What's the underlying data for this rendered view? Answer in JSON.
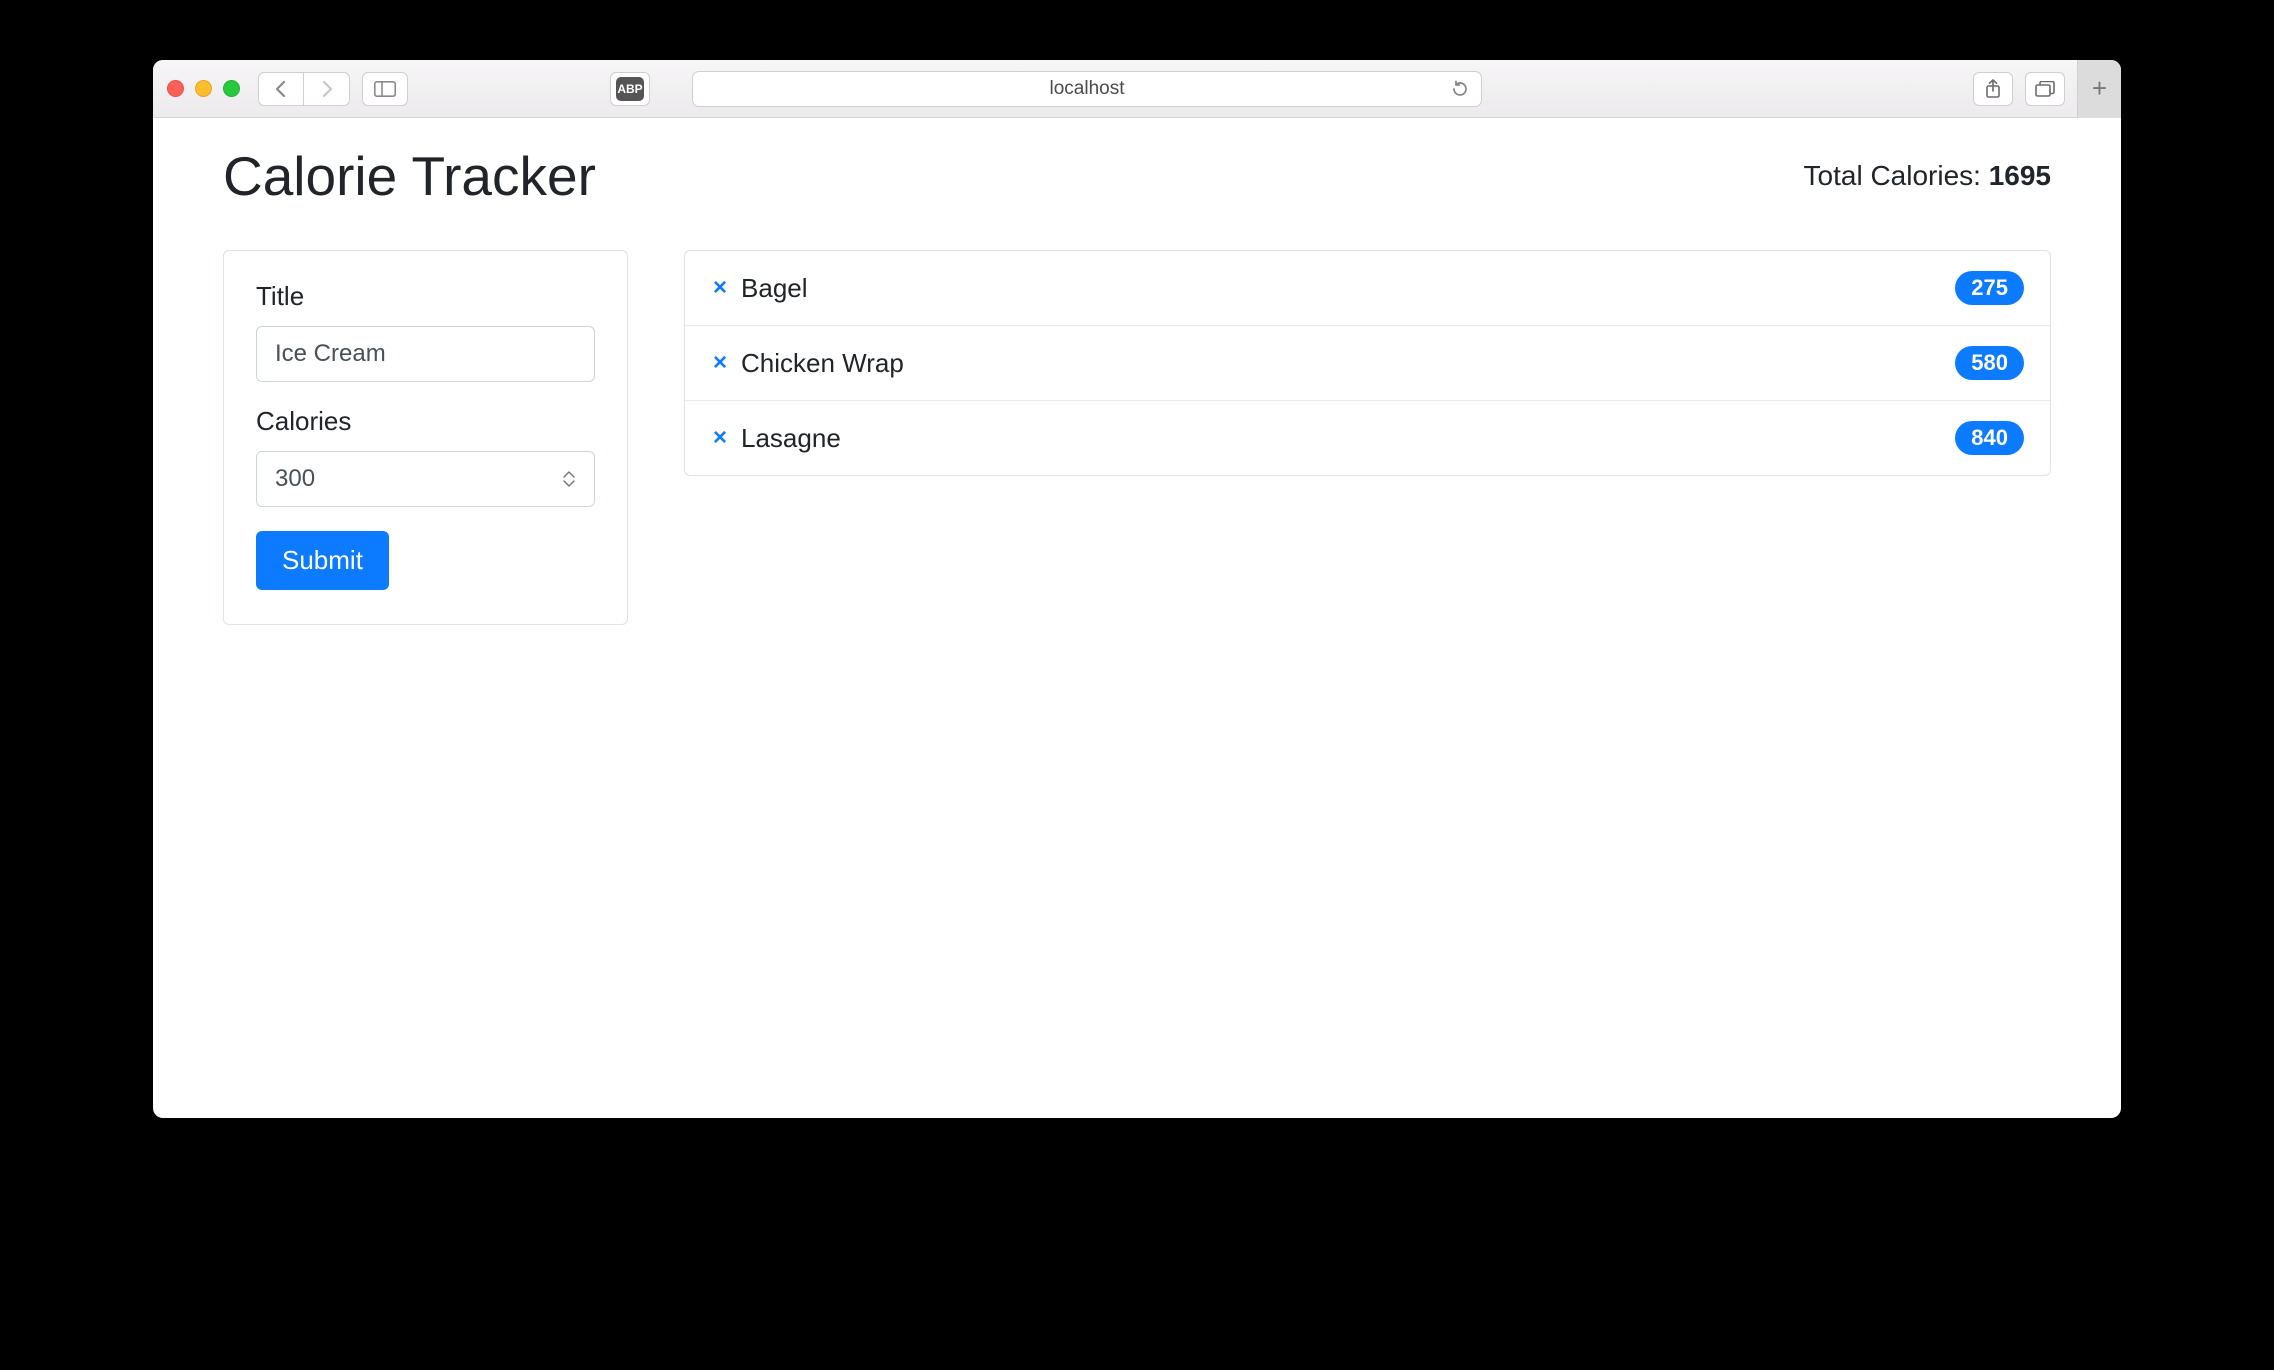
{
  "browser": {
    "address": "localhost",
    "abp_label": "ABP"
  },
  "header": {
    "title": "Calorie Tracker",
    "total_label": "Total Calories: ",
    "total_value": "1695"
  },
  "form": {
    "title_label": "Title",
    "title_value": "Ice Cream",
    "calories_label": "Calories",
    "calories_value": "300",
    "submit_label": "Submit"
  },
  "items": [
    {
      "name": "Bagel",
      "calories": "275"
    },
    {
      "name": "Chicken Wrap",
      "calories": "580"
    },
    {
      "name": "Lasagne",
      "calories": "840"
    }
  ],
  "glyphs": {
    "delete": "×",
    "plus": "+"
  }
}
